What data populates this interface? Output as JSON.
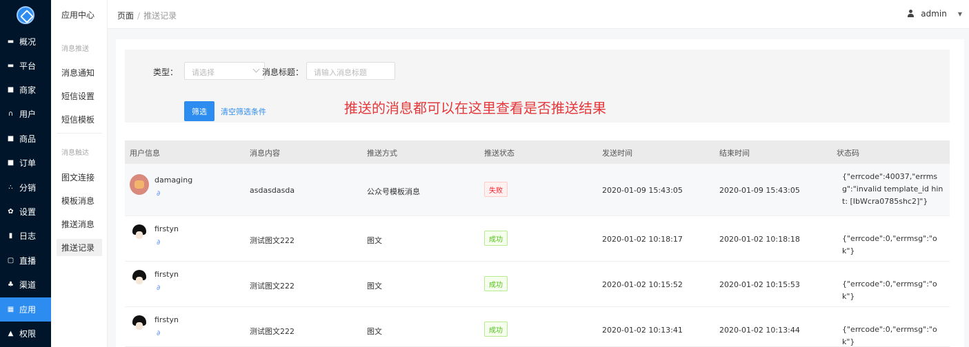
{
  "sidebar": {
    "items": [
      {
        "label": "概况",
        "icon": "monitor-icon"
      },
      {
        "label": "平台",
        "icon": "desktop-icon"
      },
      {
        "label": "商家",
        "icon": "store-icon"
      },
      {
        "label": "用户",
        "icon": "user-icon"
      },
      {
        "label": "商品",
        "icon": "goods-icon"
      },
      {
        "label": "订单",
        "icon": "order-icon"
      },
      {
        "label": "分销",
        "icon": "share-icon"
      },
      {
        "label": "设置",
        "icon": "gear-icon"
      },
      {
        "label": "日志",
        "icon": "log-icon"
      },
      {
        "label": "直播",
        "icon": "live-icon"
      },
      {
        "label": "渠道",
        "icon": "channel-icon"
      },
      {
        "label": "应用",
        "icon": "apps-icon",
        "active": true
      },
      {
        "label": "权限",
        "icon": "lock-icon"
      }
    ]
  },
  "submenu": {
    "title": "应用中心",
    "group1": "消息推送",
    "group1_items": [
      "消息通知",
      "短信设置",
      "短信模板"
    ],
    "group2": "消息触达",
    "group2_items": [
      "图文连接",
      "模板消息",
      "推送消息",
      "推送记录"
    ]
  },
  "header": {
    "breadcrumb_root": "页面",
    "breadcrumb_current": "推送记录",
    "user_name": "admin"
  },
  "filter": {
    "type_label": "类型：",
    "type_placeholder": "请选择",
    "title_label": "消息标题：",
    "title_placeholder": "请输入消息标题",
    "filter_button": "筛选",
    "clear_link": "清空筛选条件"
  },
  "annotation": "推送的消息都可以在这里查看是否推送结果",
  "table": {
    "columns": [
      "用户信息",
      "消息内容",
      "推送方式",
      "推送状态",
      "发送时间",
      "结束时间",
      "状态码"
    ],
    "rows": [
      {
        "user": "damaging",
        "content": "asdasdasda",
        "method": "公众号模板消息",
        "status": "失败",
        "sent": "2020-01-09 15:43:05",
        "ended": "2020-01-09 15:43:05",
        "code": "{\"errcode\":40037,\"errmsg\":\"invalid template_id hint: [IbWcra0785shc2]\"}"
      },
      {
        "user": "firstyn",
        "content": "测试图文222",
        "method": "图文",
        "status": "成功",
        "sent": "2020-01-02 10:18:17",
        "ended": "2020-01-02 10:18:18",
        "code": "{\"errcode\":0,\"errmsg\":\"ok\"}"
      },
      {
        "user": "firstyn",
        "content": "测试图文222",
        "method": "图文",
        "status": "成功",
        "sent": "2020-01-02 10:15:52",
        "ended": "2020-01-02 10:15:53",
        "code": "{\"errcode\":0,\"errmsg\":\"ok\"}"
      },
      {
        "user": "firstyn",
        "content": "测试图文222",
        "method": "图文",
        "status": "成功",
        "sent": "2020-01-02 10:13:41",
        "ended": "2020-01-02 10:13:44",
        "code": "{\"errcode\":0,\"errmsg\":\"ok\"}"
      }
    ]
  },
  "colors": {
    "sidebar_bg": "#001529",
    "accent": "#2d8cf0",
    "annotation": "#e4393c"
  }
}
